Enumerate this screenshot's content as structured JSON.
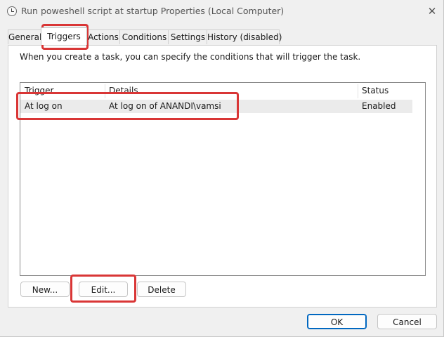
{
  "window": {
    "title": "Run poweshell script at startup Properties (Local Computer)",
    "icon": "clock-icon",
    "close_glyph": "✕"
  },
  "tabs": [
    {
      "label": "General",
      "active": false
    },
    {
      "label": "Triggers",
      "active": true
    },
    {
      "label": "Actions",
      "active": false
    },
    {
      "label": "Conditions",
      "active": false
    },
    {
      "label": "Settings",
      "active": false
    },
    {
      "label": "History (disabled)",
      "active": false
    }
  ],
  "triggers_tab": {
    "info_text": "When you create a task, you can specify the conditions that will trigger the task.",
    "columns": [
      "Trigger",
      "Details",
      "Status"
    ],
    "rows": [
      {
        "trigger": "At log on",
        "details": "At log on of ANANDI\\vamsi",
        "status": "Enabled"
      }
    ],
    "buttons": {
      "new": "New...",
      "edit": "Edit...",
      "delete": "Delete"
    }
  },
  "footer": {
    "ok": "OK",
    "cancel": "Cancel"
  },
  "colors": {
    "highlight": "#d93636",
    "accent": "#0067c0",
    "selected_row": "#ebebeb"
  }
}
